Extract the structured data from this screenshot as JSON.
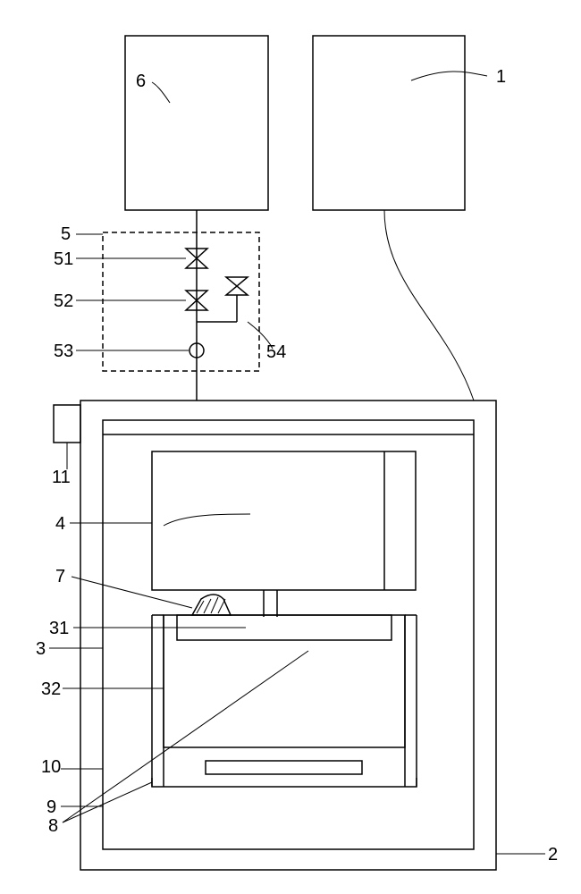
{
  "labels": {
    "l1": "1",
    "l2": "2",
    "l3": "3",
    "l4": "4",
    "l5": "5",
    "l6": "6",
    "l7": "7",
    "l8": "8",
    "l9": "9",
    "l10": "10",
    "l11": "11",
    "l31": "31",
    "l32": "32",
    "l51": "51",
    "l52": "52",
    "l53": "53",
    "l54": "54"
  }
}
